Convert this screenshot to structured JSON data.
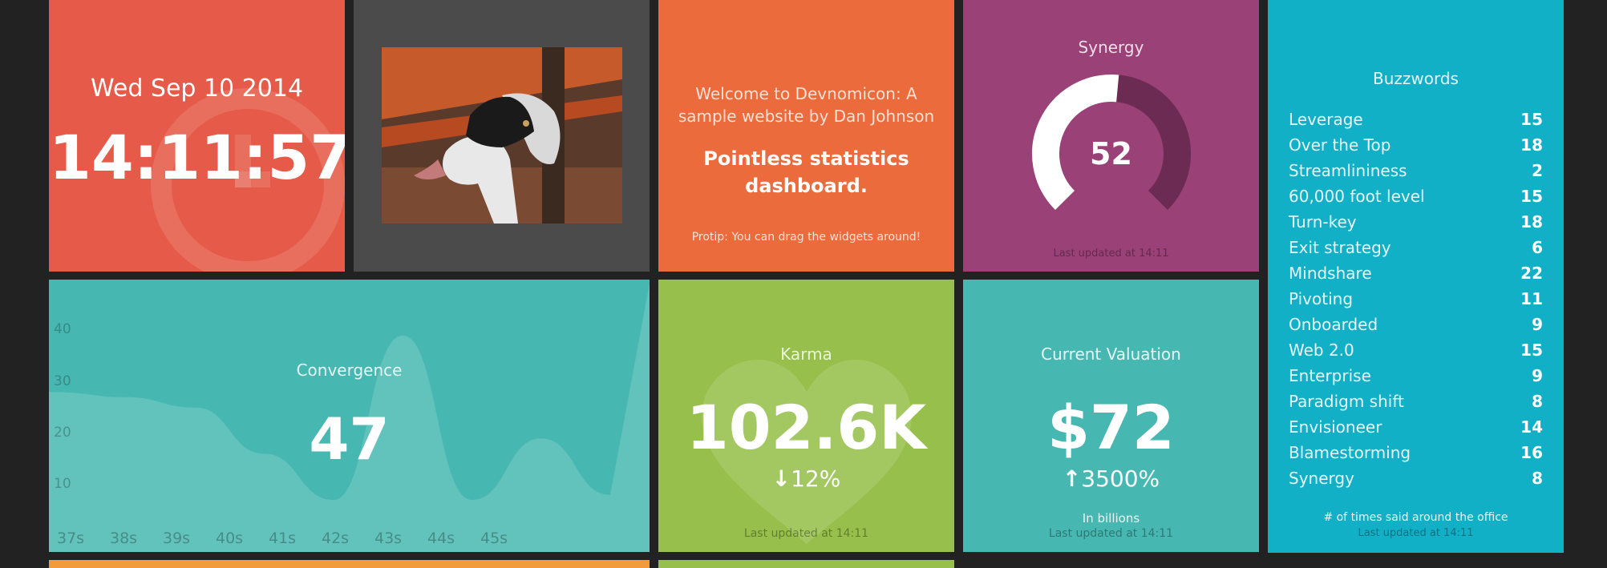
{
  "clock": {
    "date": "Wed Sep 10 2014",
    "time": "14:11:57"
  },
  "image": {
    "alt_icon": "goat-photo"
  },
  "welcome": {
    "line1": "Welcome to Devnomicon: A sample website by Dan Johnson",
    "line2": "Pointless statistics dashboard.",
    "tip": "Protip: You can drag the widgets around!"
  },
  "synergy": {
    "title": "Synergy",
    "value": "52",
    "fraction": 0.52,
    "updated": "Last updated at 14:11"
  },
  "buzzwords": {
    "title": "Buzzwords",
    "items": [
      {
        "label": "Leverage",
        "value": "15"
      },
      {
        "label": "Over the Top",
        "value": "18"
      },
      {
        "label": "Streamlininess",
        "value": "2"
      },
      {
        "label": "60,000 foot level",
        "value": "15"
      },
      {
        "label": "Turn-key",
        "value": "18"
      },
      {
        "label": "Exit strategy",
        "value": "6"
      },
      {
        "label": "Mindshare",
        "value": "22"
      },
      {
        "label": "Pivoting",
        "value": "11"
      },
      {
        "label": "Onboarded",
        "value": "9"
      },
      {
        "label": "Web 2.0",
        "value": "15"
      },
      {
        "label": "Enterprise",
        "value": "9"
      },
      {
        "label": "Paradigm shift",
        "value": "8"
      },
      {
        "label": "Envisioneer",
        "value": "14"
      },
      {
        "label": "Blamestorming",
        "value": "16"
      },
      {
        "label": "Synergy",
        "value": "8"
      }
    ],
    "footer": "# of times said around the office",
    "updated": "Last updated at 14:11"
  },
  "convergence": {
    "title": "Convergence",
    "value": "47"
  },
  "karma": {
    "title": "Karma",
    "value": "102.6K",
    "arrow": "↓",
    "change": "12%",
    "updated": "Last updated at 14:11"
  },
  "valuation": {
    "title": "Current Valuation",
    "value": "$72",
    "arrow": "↑",
    "change": "3500%",
    "more_info": "In billions",
    "updated": "Last updated at 14:11"
  },
  "colors": {
    "background": "#222222",
    "clock": "#e55a48",
    "image": "#4b4b4b",
    "welcome": "#ec6b3c",
    "synergy": "#9a4177",
    "buzzwords": "#12b0c6",
    "convergence": "#47b8b1",
    "karma": "#96c04b",
    "valuation": "#47b8b1"
  },
  "chart_data": {
    "type": "area",
    "x": [
      "37s",
      "38s",
      "39s",
      "40s",
      "41s",
      "42s",
      "43s",
      "44s",
      "45s"
    ],
    "y": [
      28,
      27,
      25,
      16,
      7,
      39,
      7,
      19,
      8
    ],
    "yticks": [
      10,
      20,
      30,
      40
    ],
    "ylim": [
      0,
      46
    ],
    "grid": false
  }
}
